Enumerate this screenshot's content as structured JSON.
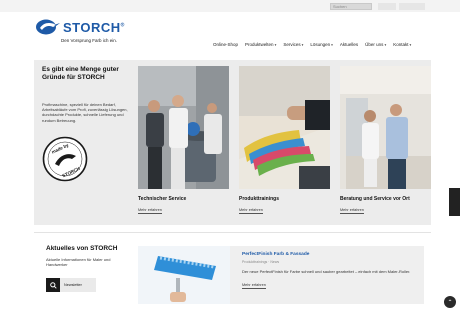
{
  "colors": {
    "brand_blue": "#1e5aa7",
    "hero_bg": "#ececec",
    "dark": "#1a1a1a"
  },
  "topbar": {
    "search_placeholder": "Suchen"
  },
  "brand": {
    "name": "STORCH",
    "registered": "®",
    "claim": "Den Vorsprung Farb ich ein."
  },
  "nav": {
    "items": [
      {
        "label": "Online-Shop",
        "has_menu": false
      },
      {
        "label": "Produktwelten",
        "has_menu": true
      },
      {
        "label": "Services",
        "has_menu": true
      },
      {
        "label": "Lösungen",
        "has_menu": true
      },
      {
        "label": "Aktuelles",
        "has_menu": false
      },
      {
        "label": "Über uns",
        "has_menu": true
      },
      {
        "label": "Kontakt",
        "has_menu": true
      }
    ]
  },
  "hero": {
    "title": "Es gibt eine Menge guter Gründe für STORCH",
    "text": "Profimaschine, speziell für deinen Bedarf, Arbeitsabläufe vom Profi, zuverlässig Lösungen, durchdachte Produkte, schnelle Lieferung und rundum Betreuung.",
    "badge_text": "made by STORCH",
    "tiles": [
      {
        "title": "Technischer Service",
        "link": "Mehr erfahren"
      },
      {
        "title": "Produkttrainings",
        "link": "Mehr erfahren"
      },
      {
        "title": "Beratung und Service vor Ort",
        "link": "Mehr erfahren"
      }
    ]
  },
  "news": {
    "title": "Aktuelles von STORCH",
    "text": "Aktuelle Informationen für Maler und Handwerker",
    "button_label": "Newsletter",
    "card": {
      "headline": "PerfectFinish Farb & Fassade",
      "meta": "Produkttrainings · News",
      "text": "Der neue PerfectFinish für Farbe schnell und sauber gearbeitet – einfach mit dem Maler-Roller.",
      "link": "Mehr erfahren"
    }
  }
}
